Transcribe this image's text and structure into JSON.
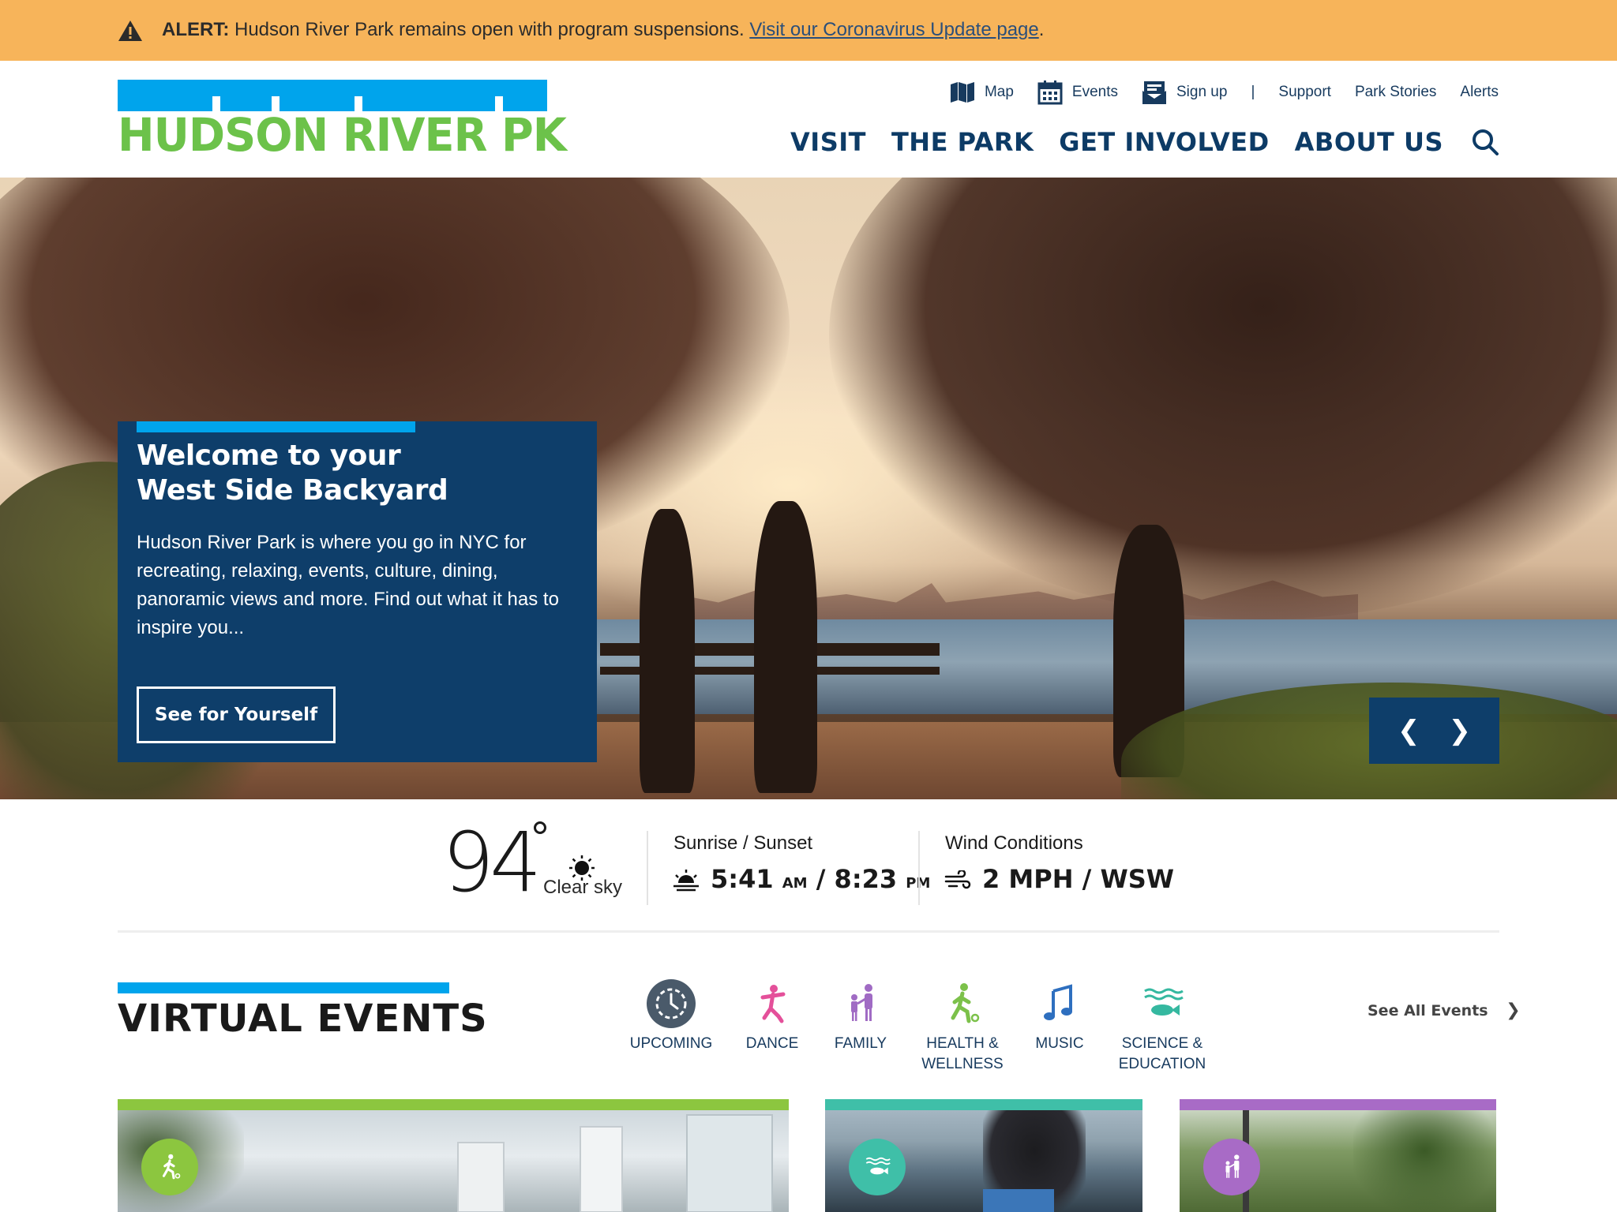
{
  "alert": {
    "label": "ALERT:",
    "message": "Hudson River Park remains open with program suspensions.",
    "link": "Visit our Coronavirus Update page",
    "trailing": "."
  },
  "logo": {
    "text": "HUDSON RIVER PK"
  },
  "utility_nav": [
    {
      "label": "Map",
      "icon": "map-icon"
    },
    {
      "label": "Events",
      "icon": "calendar-icon"
    },
    {
      "label": "Sign up",
      "icon": "mail-icon"
    },
    {
      "label": "Support"
    },
    {
      "label": "Park Stories"
    },
    {
      "label": "Alerts"
    }
  ],
  "utility_separator": "|",
  "main_nav": [
    "VISIT",
    "THE PARK",
    "GET INVOLVED",
    "ABOUT US"
  ],
  "hero": {
    "title_line1": "Welcome to your",
    "title_line2": "West Side Backyard",
    "body": "Hudson River Park is where you go in NYC for recreating, relaxing, events, culture, dining, panoramic views and more. Find out what it has to inspire you...",
    "cta": "See for Yourself",
    "prev": "❮",
    "next": "❯"
  },
  "weather": {
    "temperature": "94",
    "condition": "Clear sky",
    "sun_label": "Sunrise / Sunset",
    "sunrise": "5:41",
    "sunrise_suffix": "AM",
    "sunset": "8:23",
    "sunset_suffix": "PM",
    "separator": " / ",
    "wind_label": "Wind Conditions",
    "wind_value": "2 MPH / WSW"
  },
  "events": {
    "title": "VIRTUAL EVENTS",
    "see_all": "See All Events",
    "categories": [
      {
        "line1": "UPCOMING",
        "line2": "",
        "icon": "clock-icon",
        "color": "#4a5a6a"
      },
      {
        "line1": "DANCE",
        "line2": "",
        "icon": "dancer-icon",
        "color": "#e4509a"
      },
      {
        "line1": "FAMILY",
        "line2": "",
        "icon": "family-icon",
        "color": "#a06bc4"
      },
      {
        "line1": "HEALTH &",
        "line2": "WELLNESS",
        "icon": "runner-icon",
        "color": "#7cc14a"
      },
      {
        "line1": "MUSIC",
        "line2": "",
        "icon": "music-note-icon",
        "color": "#2e6fbf"
      },
      {
        "line1": "SCIENCE &",
        "line2": "EDUCATION",
        "icon": "fish-icon",
        "color": "#35b8a0"
      }
    ],
    "cards": [
      {
        "accent": "#8cc63f",
        "icon": "runner-icon"
      },
      {
        "accent": "#3fbfa8",
        "icon": "fish-icon"
      },
      {
        "accent": "#a86bc6",
        "icon": "family-icon"
      }
    ]
  },
  "colors": {
    "alert_bg": "#f7b45a",
    "brand_blue": "#00a4ec",
    "brand_green": "#6cc24a",
    "navy": "#0e3e6a"
  }
}
